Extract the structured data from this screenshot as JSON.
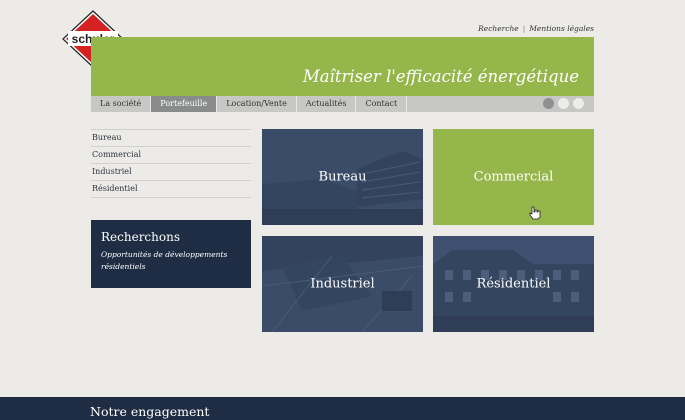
{
  "brand": {
    "logo_text": "schuler"
  },
  "utility": {
    "search_label": "Recherche",
    "separator": "|",
    "legal_label": "Mentions légales"
  },
  "banner": {
    "tagline": "Maîtriser l'efficacité énergétique"
  },
  "nav": {
    "items": [
      {
        "label": "La société"
      },
      {
        "label": "Portefeuille"
      },
      {
        "label": "Location/Vente"
      },
      {
        "label": "Actualités"
      },
      {
        "label": "Contact"
      }
    ],
    "active": "Portefeuille"
  },
  "slider": {
    "dots": 3,
    "active_index": 0
  },
  "sidebar": {
    "items": [
      {
        "label": "Bureau"
      },
      {
        "label": "Commercial"
      },
      {
        "label": "Industriel"
      },
      {
        "label": "Résidentiel"
      }
    ]
  },
  "research": {
    "title": "Recherchons",
    "text": "Opportunités de développements résidentiels"
  },
  "tiles": [
    {
      "label": "Bureau"
    },
    {
      "label": "Commercial"
    },
    {
      "label": "Industriel"
    },
    {
      "label": "Résidentiel"
    }
  ],
  "footer": {
    "title": "Notre engagement"
  },
  "colors": {
    "green": "#95b64a",
    "navy": "#1e2d44",
    "tile_blue": "#3b4c68",
    "logo_red": "#d42121"
  }
}
